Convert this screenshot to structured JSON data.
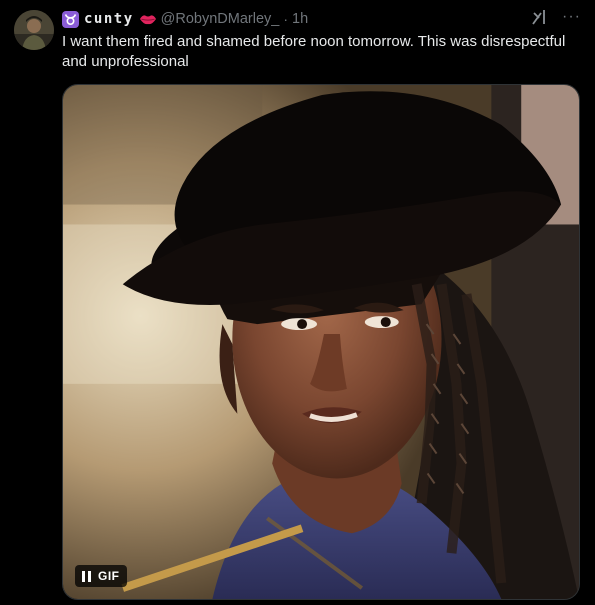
{
  "author": {
    "display_name": "cunty",
    "handle": "@RobynDMarley_",
    "separator": "·",
    "time_ago": "1h",
    "name_icon_left": "taurus-sign-icon",
    "name_icon_right": "lips-icon"
  },
  "tweet": {
    "text": "I want them fired and shamed before noon tomorrow. This was disrespectful and unprofessional"
  },
  "media": {
    "type_label": "GIF",
    "control_icon": "pause-icon"
  },
  "actions": {
    "grok_icon": "grok-icon",
    "more_icon": "more-icon"
  },
  "colors": {
    "background": "#000000",
    "text_primary": "#e7e9ea",
    "text_secondary": "#71767b",
    "sign_badge": "#8a5cd6",
    "lips": "#e0245e"
  }
}
